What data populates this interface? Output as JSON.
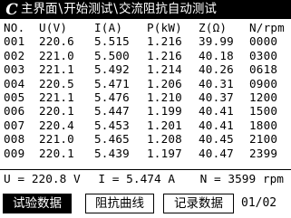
{
  "title_bar": {
    "logo_text": "C",
    "crumbs": [
      "主界面",
      "开始测试",
      "交流阻抗自动测试"
    ],
    "separator": "\\"
  },
  "table": {
    "headers": [
      "NO.",
      "U(V)",
      "I(A)",
      "P(kW)",
      "Z(Ω)",
      "N/rpm"
    ],
    "rows": [
      [
        "001",
        "220.6",
        "5.515",
        "1.216",
        "39.99",
        "0000"
      ],
      [
        "002",
        "221.0",
        "5.500",
        "1.216",
        "40.18",
        "0300"
      ],
      [
        "003",
        "221.1",
        "5.492",
        "1.214",
        "40.26",
        "0618"
      ],
      [
        "004",
        "220.5",
        "5.471",
        "1.206",
        "40.31",
        "0900"
      ],
      [
        "005",
        "221.1",
        "5.476",
        "1.210",
        "40.37",
        "1200"
      ],
      [
        "006",
        "220.1",
        "5.447",
        "1.199",
        "40.41",
        "1500"
      ],
      [
        "007",
        "220.4",
        "5.453",
        "1.201",
        "40.41",
        "1800"
      ],
      [
        "008",
        "221.0",
        "5.465",
        "1.208",
        "40.45",
        "2100"
      ],
      [
        "009",
        "220.1",
        "5.439",
        "1.197",
        "40.47",
        "2399"
      ]
    ]
  },
  "readout": {
    "voltage": "U = 220.8 V",
    "current": "I = 5.474 A",
    "speed": "N = 3599 rpm"
  },
  "buttons": [
    {
      "label": "试验数据",
      "active": true
    },
    {
      "label": "阻抗曲线",
      "active": false
    },
    {
      "label": "记录数据",
      "active": false
    }
  ],
  "page_indicator": "01/02"
}
